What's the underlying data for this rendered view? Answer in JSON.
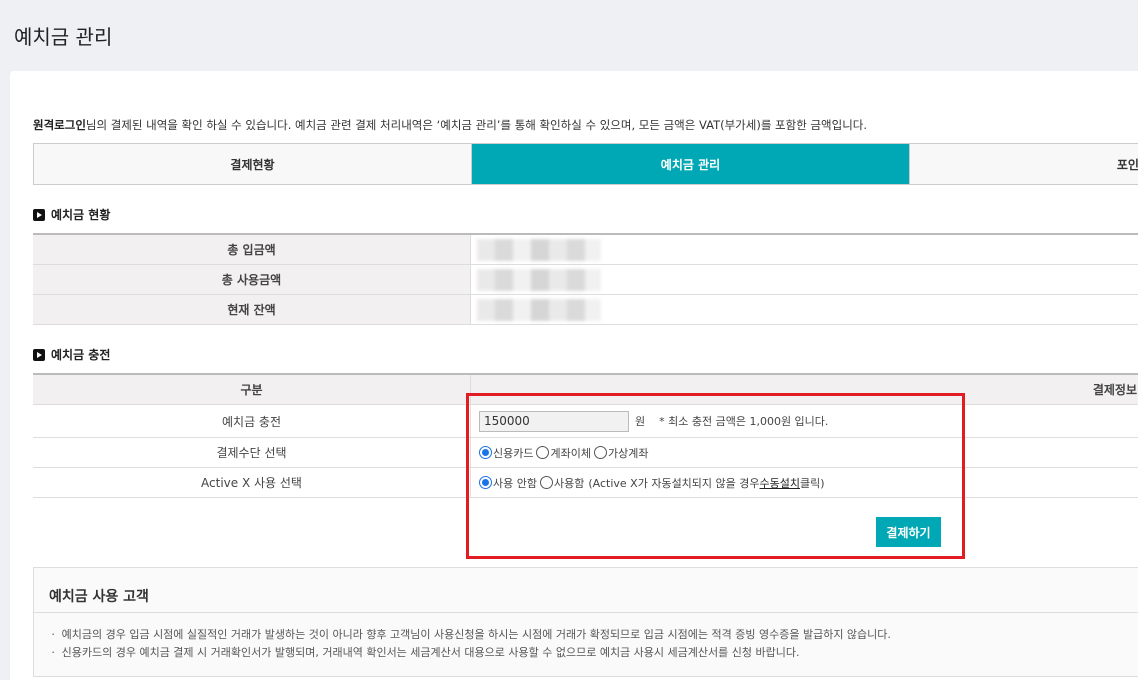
{
  "page": {
    "title": "예치금 관리"
  },
  "notice": {
    "user": "원격로그인",
    "text": "님의 결제된 내역을 확인 하실 수 있습니다. 예치금 관련 결제 처리내역은 ‘예치금 관리’를 통해 확인하실 수 있으며, 모든 금액은 VAT(부가세)를 포함한 금액입니다."
  },
  "tabs": [
    {
      "label": "결제현황",
      "active": false
    },
    {
      "label": "예치금 관리",
      "active": true
    },
    {
      "label": "포인트 ",
      "active": false
    }
  ],
  "status_section": {
    "title": "예치금 현황",
    "rows": [
      {
        "label": "총 입금액"
      },
      {
        "label": "총 사용금액"
      },
      {
        "label": "현재 잔액"
      }
    ]
  },
  "charge_section": {
    "title": "예치금 충전",
    "head": {
      "col1": "구분",
      "col2": "결제정보"
    },
    "amount_row": {
      "label": "예치금 충전",
      "value": "150000",
      "unit": "원",
      "note": "* 최소 충전 금액은 1,000원 입니다."
    },
    "method_row": {
      "label": "결제수단 선택",
      "options": [
        {
          "label": "신용카드",
          "checked": true
        },
        {
          "label": "계좌이체",
          "checked": false
        },
        {
          "label": "가상계좌",
          "checked": false
        }
      ]
    },
    "activex_row": {
      "label": "Active X 사용 선택",
      "options": [
        {
          "label": "사용 안함",
          "checked": true
        },
        {
          "label": "사용함",
          "checked": false
        }
      ],
      "hint_prefix": "(Active X가 자동설치되지 않을 경우 ",
      "hint_link": "수동설치",
      "hint_suffix": " 클릭)"
    },
    "pay_button": "결제하기"
  },
  "info": {
    "title": "예치금 사용 고객",
    "items": [
      "ㆍ 예치금의 경우 입금 시점에 실질적인 거래가 발생하는 것이 아니라 향후 고객님이 사용신청을 하시는 시점에 거래가 확정되므로 입금 시점에는 적격 증빙 영수증을 발급하지 않습니다.",
      "ㆍ 신용카드의 경우 예치금 결제 시 거래확인서가 발행되며, 거래내역 확인서는 세금계산서 대용으로 사용할 수 없으므로 예치금 사용시 세금계산서를 신청 바랍니다."
    ]
  },
  "colors": {
    "accent": "#00a8b5",
    "highlight": "#e31b23",
    "radio": "#1a73e8"
  }
}
